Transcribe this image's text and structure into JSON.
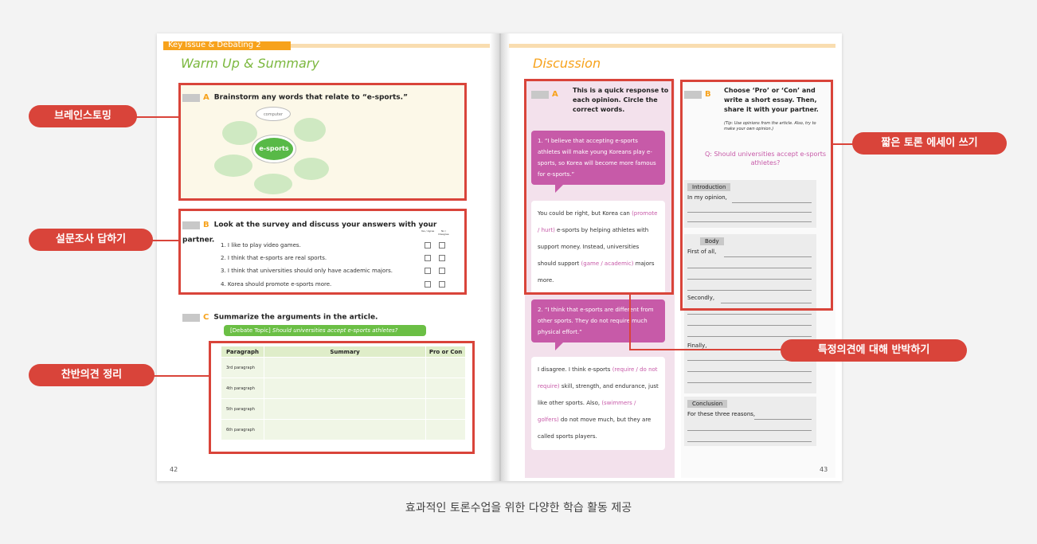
{
  "left_page": {
    "header_label": "Key Issue & Debating 2",
    "section_title": "Warm Up & Summary",
    "activity_a": {
      "letter": "A",
      "instruction": "Brainstorm any words that relate to “e-sports.”",
      "center_word": "e-sports",
      "sample_word": "computer"
    },
    "activity_b": {
      "letter": "B",
      "instruction": "Look at the survey and discuss your answers with your partner.",
      "col_agree": "Yes / Agree",
      "col_disagree": "No / Disagree",
      "items": [
        "1. I like to play video games.",
        "2. I think that e-sports are real sports.",
        "3. I think that universities should only have academic majors.",
        "4. Korea should promote e-sports more."
      ]
    },
    "activity_c": {
      "letter": "C",
      "instruction": "Summarize the arguments in the article.",
      "topic_label": "[Debate Topic]",
      "topic": "Should universities accept e-sports athletes?",
      "table_headers": [
        "Paragraph",
        "Summary",
        "Pro or Con"
      ],
      "rows": [
        "3rd paragraph",
        "4th paragraph",
        "5th paragraph",
        "6th paragraph"
      ]
    },
    "page_number": "42"
  },
  "right_page": {
    "section_title": "Discussion",
    "activity_a": {
      "letter": "A",
      "instruction": "This is a quick response to each opinion. Circle the correct words.",
      "opinion1": "1. “I believe that accepting e-sports athletes will make young Koreans play e-sports, so Korea will become more famous for e-sports.”",
      "reply1_a": "You could be right, but Korea can ",
      "reply1_choice1": "(promote / hurt)",
      "reply1_b": " e-sports by helping athletes with support money. Instead, universities should support ",
      "reply1_choice2": "(game / academic)",
      "reply1_c": " majors more.",
      "opinion2": "2. “I think that e-sports are different from other sports. They do not require much physical effort.”",
      "reply2_a": "I disagree. I think e-sports ",
      "reply2_choice1": "(require / do not require)",
      "reply2_b": " skill, strength, and endurance, just like other sports. Also, ",
      "reply2_choice2": "(swimmers / golfers)",
      "reply2_c": " do not move much, but they are called sports players."
    },
    "activity_b": {
      "letter": "B",
      "instruction": "Choose ‘Pro’ or ‘Con’ and write a short essay. Then, share it with your partner.",
      "tip": "(Tip: Use opinions from the article. Also, try to make your own opinion.)",
      "question": "Q: Should universities accept e-sports athletes?",
      "intro_label": "Introduction",
      "intro_text": "In my opinion,",
      "body_label": "Body",
      "body_first": "First of all,",
      "body_second": "Secondly,",
      "body_finally": "Finally,",
      "conclusion_label": "Conclusion",
      "conclusion_text": "For these three reasons,"
    },
    "page_number": "43"
  },
  "callouts": {
    "brainstorm": "브레인스토밍",
    "survey": "설문조사 답하기",
    "summary": "찬반의견 정리",
    "essay": "짧은 토론 에세이 쓰기",
    "rebuttal": "특정의견에 대해 반박하기"
  },
  "caption": "효과적인 토론수업을 위한 다양한 학습 활동 제공",
  "colors": {
    "callout_red": "#d9443a",
    "green": "#7cb83f",
    "orange": "#f7a21b",
    "pink": "#c75aa8"
  }
}
